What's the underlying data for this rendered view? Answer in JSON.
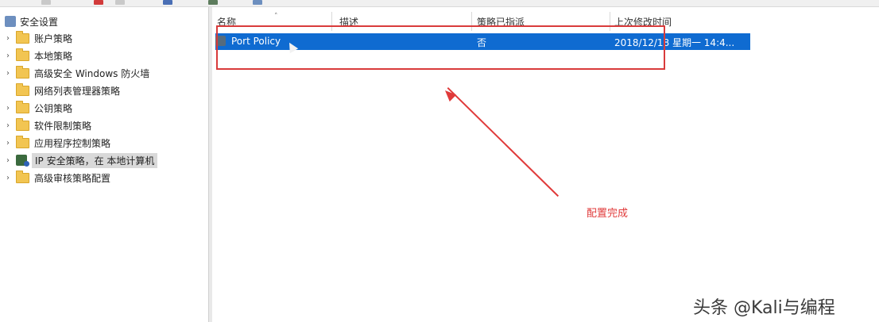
{
  "tree": {
    "root_label": "安全设置",
    "items": [
      {
        "label": "账户策略",
        "expandable": true,
        "icon": "folder-icon"
      },
      {
        "label": "本地策略",
        "expandable": true,
        "icon": "folder-icon"
      },
      {
        "label": "高级安全 Windows 防火墙",
        "expandable": true,
        "icon": "folder-icon"
      },
      {
        "label": "网络列表管理器策略",
        "expandable": false,
        "icon": "folder-icon"
      },
      {
        "label": "公钥策略",
        "expandable": true,
        "icon": "folder-icon"
      },
      {
        "label": "软件限制策略",
        "expandable": true,
        "icon": "folder-icon"
      },
      {
        "label": "应用程序控制策略",
        "expandable": true,
        "icon": "folder-icon"
      },
      {
        "label": "IP 安全策略，在 本地计算机",
        "expandable": true,
        "icon": "ip-policy-icon",
        "selected": true
      },
      {
        "label": "高级审核策略配置",
        "expandable": true,
        "icon": "folder-icon"
      }
    ]
  },
  "list": {
    "columns": [
      "名称",
      "描述",
      "策略已指派",
      "上次修改时间"
    ],
    "rows": [
      {
        "name": "Port Policy",
        "description": "",
        "assigned": "否",
        "modified": "2018/12/18 星期一 14:4..."
      }
    ]
  },
  "annotation": {
    "text": "配置完成",
    "color": "#e03a3a"
  },
  "watermark": "头条 @Kali与编程",
  "colors": {
    "selection": "#0f6bd1",
    "annotation": "#e03a3a",
    "folder": "#f2c552"
  }
}
